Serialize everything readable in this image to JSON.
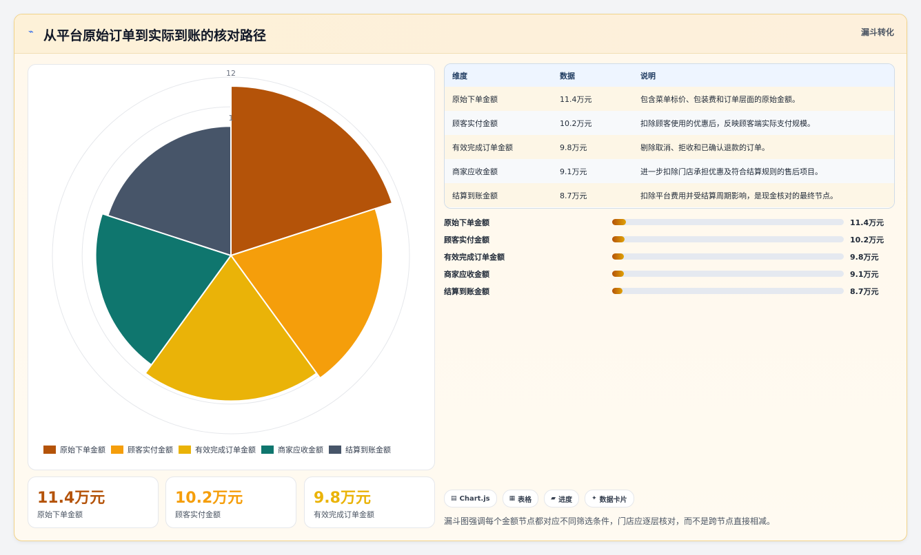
{
  "header": {
    "title": "从平台原始订单到实际到账的核对路径",
    "badge": "漏斗转化",
    "icon": "spark-icon"
  },
  "chart_data": {
    "type": "polarArea",
    "radial_ticks": [
      "12",
      "1"
    ],
    "r_max": 12,
    "categories": [
      "原始下单金额",
      "顾客实付金额",
      "有效完成订单金额",
      "商家应收金额",
      "结算到账金额"
    ],
    "values": [
      11.4,
      10.2,
      9.8,
      9.1,
      8.7
    ],
    "colors": [
      "#b45309",
      "#f59e0b",
      "#eab308",
      "#0f766e",
      "#475569"
    ],
    "legend_position": "bottom"
  },
  "stats": [
    {
      "value": "11.4万元",
      "label": "原始下单金额",
      "color": "#b45309"
    },
    {
      "value": "10.2万元",
      "label": "顾客实付金额",
      "color": "#f59e0b"
    },
    {
      "value": "9.8万元",
      "label": "有效完成订单金额",
      "color": "#eab308"
    }
  ],
  "table": {
    "headers": [
      "维度",
      "数据",
      "说明"
    ],
    "rows": [
      [
        "原始下单金额",
        "11.4万元",
        "包含菜单标价、包装费和订单层面的原始金额。"
      ],
      [
        "顾客实付金额",
        "10.2万元",
        "扣除顾客使用的优惠后，反映顾客端实际支付规模。"
      ],
      [
        "有效完成订单金额",
        "9.8万元",
        "剔除取消、拒收和已确认退款的订单。"
      ],
      [
        "商家应收金额",
        "9.1万元",
        "进一步扣除门店承担优惠及符合结算规则的售后项目。"
      ],
      [
        "结算到账金额",
        "8.7万元",
        "扣除平台费用并受结算周期影响，是现金核对的最终节点。"
      ]
    ]
  },
  "progress": [
    {
      "label": "原始下单金额",
      "value": "11.4万元",
      "fraction": 0.06
    },
    {
      "label": "顾客实付金额",
      "value": "10.2万元",
      "fraction": 0.055
    },
    {
      "label": "有效完成订单金额",
      "value": "9.8万元",
      "fraction": 0.05
    },
    {
      "label": "商家应收金额",
      "value": "9.1万元",
      "fraction": 0.05
    },
    {
      "label": "结算到账金额",
      "value": "8.7万元",
      "fraction": 0.045
    }
  ],
  "chips": [
    {
      "label": "Chart.js",
      "icon": "chart-icon"
    },
    {
      "label": "表格",
      "icon": "table-icon"
    },
    {
      "label": "进度",
      "icon": "progress-icon"
    },
    {
      "label": "数据卡片",
      "icon": "card-icon"
    }
  ],
  "footnote": "漏斗图强调每个金额节点都对应不同筛选条件，门店应逐层核对，而不是跨节点直接相减。"
}
